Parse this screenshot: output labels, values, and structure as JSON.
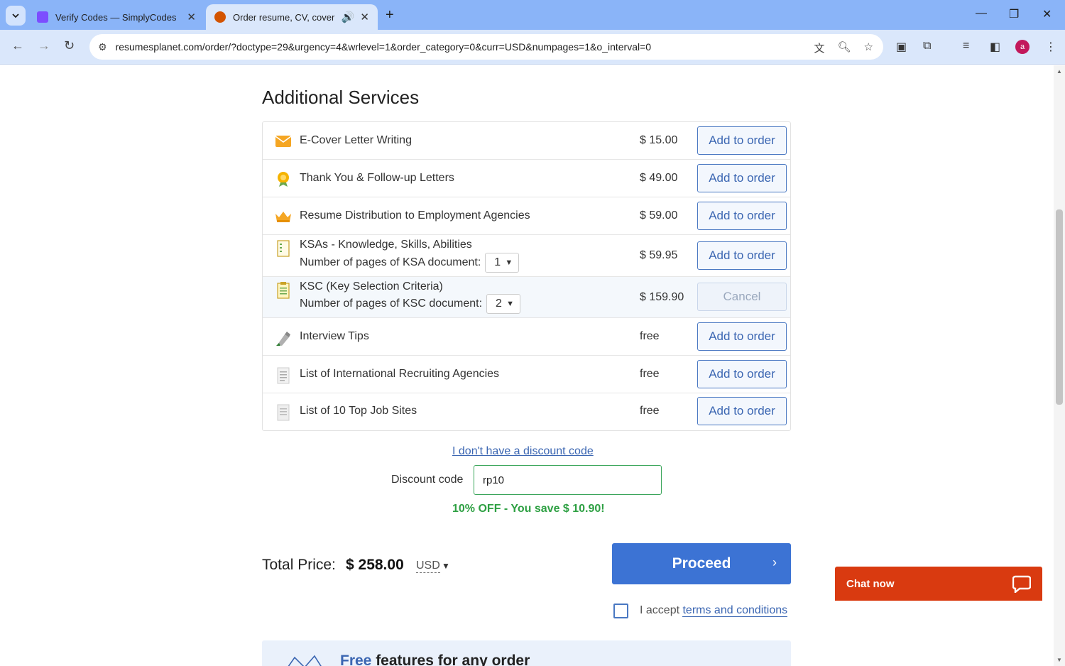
{
  "browser": {
    "tabs": [
      {
        "title": "Verify Codes — SimplyCodes",
        "favicon_color": "#7c4dff"
      },
      {
        "title": "Order resume, CV, cover let",
        "favicon_color": "#d35400"
      }
    ],
    "url": "resumesplanet.com/order/?doctype=29&urgency=4&wrlevel=1&order_category=0&curr=USD&numpages=1&o_interval=0",
    "profile_initial": "a"
  },
  "section_title": "Additional Services",
  "services": [
    {
      "name": "E-Cover Letter Writing",
      "price": "$ 15.00",
      "action": "Add to order",
      "icon": "envelope-icon"
    },
    {
      "name": "Thank You & Follow-up Letters",
      "price": "$ 49.00",
      "action": "Add to order",
      "icon": "medal-icon"
    },
    {
      "name": "Resume Distribution to Employment Agencies",
      "price": "$ 59.00",
      "action": "Add to order",
      "icon": "crown-icon"
    },
    {
      "name": "KSAs - Knowledge, Skills, Abilities",
      "sub_label": "Number of pages of KSA document:",
      "pages": "1",
      "price": "$ 59.95",
      "action": "Add to order",
      "icon": "checklist-icon"
    },
    {
      "name": "KSC (Key Selection Criteria)",
      "sub_label": "Number of pages of KSC document:",
      "pages": "2",
      "price": "$ 159.90",
      "action": "Cancel",
      "icon": "document-icon"
    },
    {
      "name": "Interview Tips",
      "price": "free",
      "action": "Add to order",
      "icon": "pen-icon"
    },
    {
      "name": "List of International Recruiting Agencies",
      "price": "free",
      "action": "Add to order",
      "icon": "list-icon"
    },
    {
      "name": "List of 10 Top Job Sites",
      "price": "free",
      "action": "Add to order",
      "icon": "page-icon"
    }
  ],
  "discount": {
    "no_code_link": "I don't have a discount code",
    "label": "Discount code",
    "value": "rp10",
    "message": "10% OFF - You save $ 10.90!"
  },
  "total": {
    "label": "Total Price:",
    "value": "$ 258.00",
    "currency": "USD"
  },
  "proceed_label": "Proceed",
  "terms": {
    "prefix": "I accept ",
    "link": "terms and conditions"
  },
  "features": {
    "accent": "Free",
    "rest": " features for any order"
  },
  "chat_label": "Chat now",
  "colors": {
    "accent": "#3c73d4",
    "success": "#2ea043",
    "chat": "#d93a10"
  }
}
